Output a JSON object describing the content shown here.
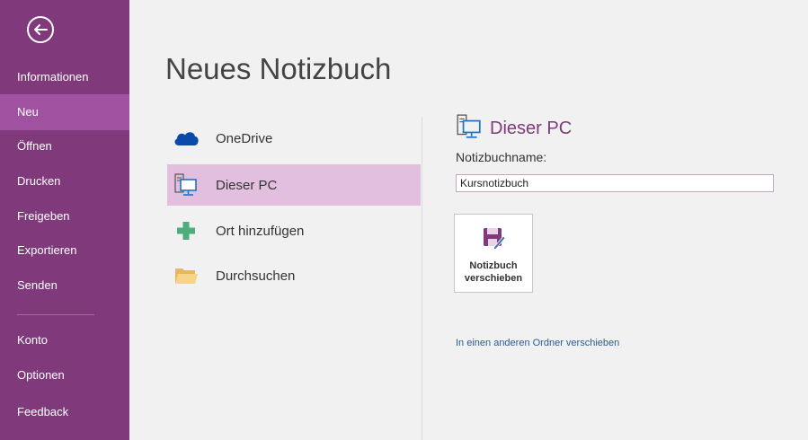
{
  "sidebar": {
    "back_icon": "back-arrow-circle-icon",
    "items": [
      {
        "label": "Informationen"
      },
      {
        "label": "Neu"
      },
      {
        "label": "Öffnen"
      },
      {
        "label": "Drucken"
      },
      {
        "label": "Freigeben"
      },
      {
        "label": "Exportieren"
      },
      {
        "label": "Senden"
      },
      {
        "label": "Konto"
      },
      {
        "label": "Optionen"
      },
      {
        "label": "Feedback"
      }
    ],
    "selected": "Neu"
  },
  "main": {
    "title": "Neues Notizbuch",
    "locations": [
      {
        "label": "OneDrive",
        "icon": "cloud-icon"
      },
      {
        "label": "Dieser PC",
        "icon": "computer-icon"
      },
      {
        "label": "Ort hinzufügen",
        "icon": "plus-icon"
      },
      {
        "label": "Durchsuchen",
        "icon": "folder-icon"
      }
    ],
    "selected_location": "Dieser PC"
  },
  "details": {
    "heading": "Dieser PC",
    "heading_icon": "computer-icon",
    "name_label": "Notizbuchname:",
    "name_value": "Kursnotizbuch",
    "move_button": {
      "line1": "Notizbuch",
      "line2": "verschieben",
      "icon": "save-pen-icon"
    },
    "other_folder_link": "In einen anderen Ordner verschieben"
  },
  "colors": {
    "sidebar": "#80397b",
    "sidebar_selected": "#a052a0",
    "location_selected": "#e2bfdf",
    "accent": "#80397b",
    "link": "#2a5c9a",
    "background": "#f1f1f1"
  }
}
